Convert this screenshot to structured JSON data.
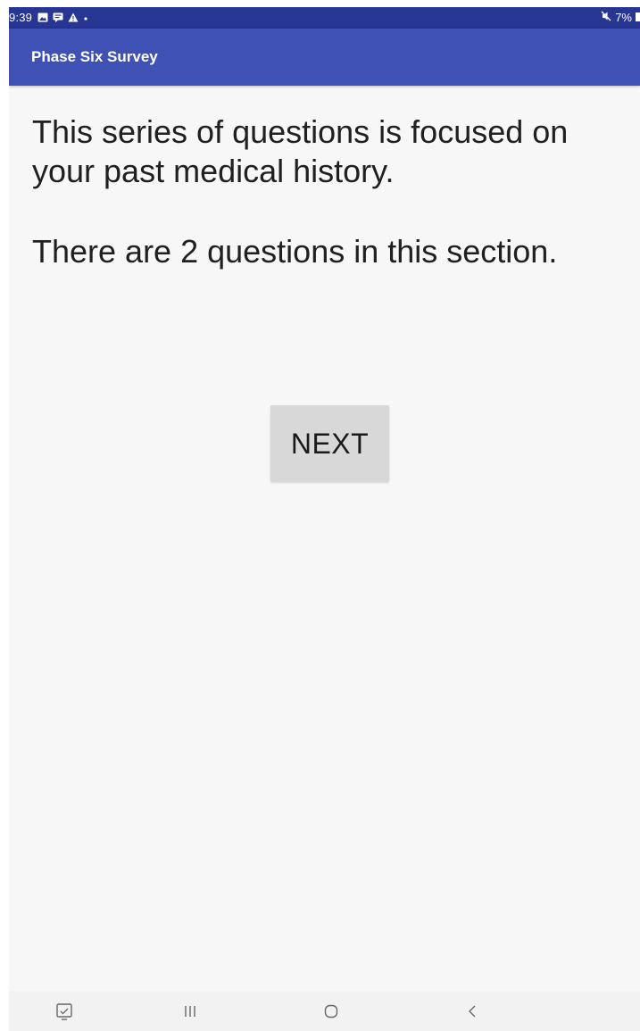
{
  "status_bar": {
    "time": "9:39",
    "battery": "7%"
  },
  "app_bar": {
    "title": "Phase Six Survey"
  },
  "content": {
    "intro_text": "This series of questions is focused on your past medical history.",
    "count_text": "There are 2 questions in this section."
  },
  "next_button": {
    "label": "NEXT"
  },
  "nav_bar": {
    "items": [
      "screenshot-icon",
      "recent-apps-icon",
      "home-icon",
      "back-icon"
    ]
  },
  "colors": {
    "status_bar": "#273593",
    "app_bar": "#3f51b5",
    "background": "#f7f7f7",
    "button": "#d8d8d8"
  }
}
